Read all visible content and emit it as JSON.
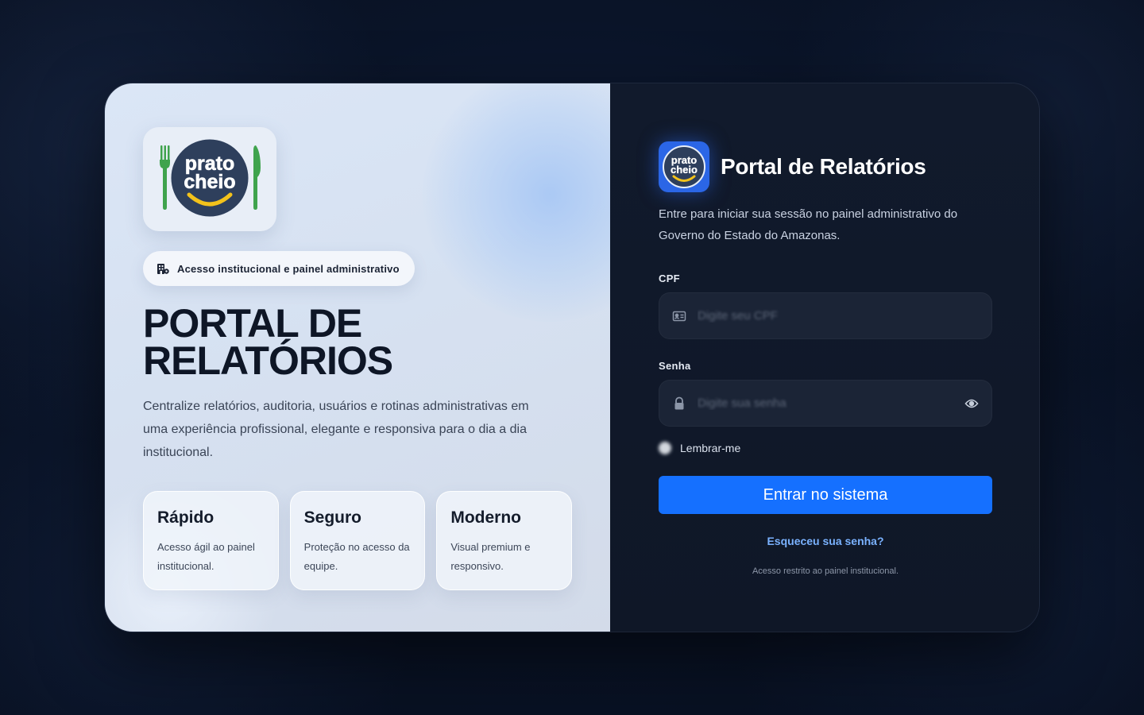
{
  "app": {
    "logo_text_line1": "prato",
    "logo_text_line2": "cheio"
  },
  "left": {
    "pill_label": "Acesso institucional e painel administrativo",
    "pill_icon": "building-icon",
    "title": "PORTAL DE RELATÓRIOS",
    "description": "Centralize relatórios, auditoria, usuários e rotinas administrativas em uma experiência profissional, elegante e responsiva para o dia a dia institucional.",
    "features": [
      {
        "title": "Rápido",
        "text": "Acesso ágil ao painel institucional."
      },
      {
        "title": "Seguro",
        "text": "Proteção no acesso da equipe."
      },
      {
        "title": "Moderno",
        "text": "Visual premium e responsivo."
      }
    ]
  },
  "right": {
    "title": "Portal de Relatórios",
    "subtitle": "Entre para iniciar sua sessão no painel administrativo do Governo do Estado do Amazonas.",
    "cpf": {
      "label": "CPF",
      "placeholder": "Digite seu CPF",
      "value": "",
      "icon": "id-card-icon"
    },
    "senha": {
      "label": "Senha",
      "placeholder": "Digite sua senha",
      "value": "",
      "icon": "lock-icon",
      "toggle_icon": "eye-icon"
    },
    "remember_label": "Lembrar-me",
    "submit_label": "Entrar no sistema",
    "forgot_label": "Esqueceu sua senha?",
    "restricted_note": "Acesso restrito ao painel institucional."
  },
  "colors": {
    "accent": "#1570ff",
    "link": "#7ab2ff",
    "logo_green": "#3fa34d",
    "logo_navy": "#2e3f5c",
    "logo_yellow": "#f3c21b"
  }
}
